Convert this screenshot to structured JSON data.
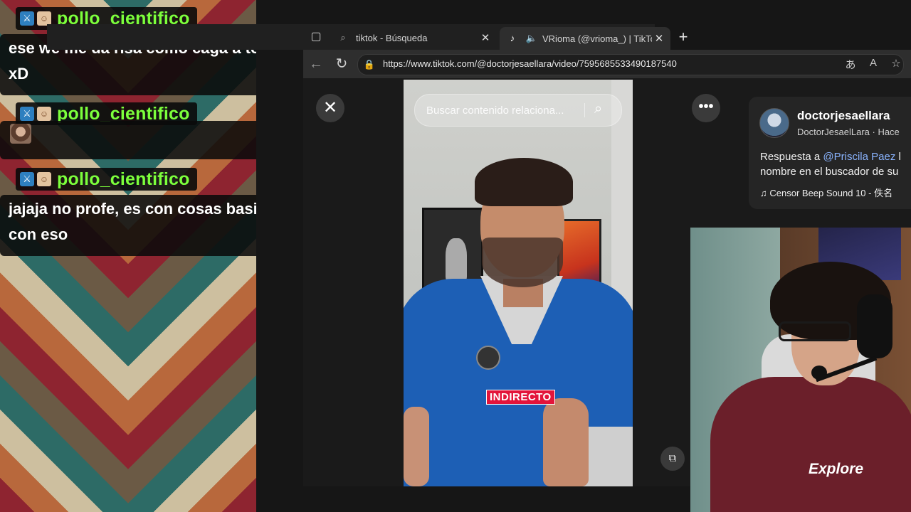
{
  "chat": {
    "messages": [
      {
        "username": "pollo_cientifico",
        "text_line1": "ese we me da risa como caga a todos",
        "text_line2": "xD"
      },
      {
        "username": "pollo_cientifico",
        "emote": "face-emote"
      },
      {
        "username": "pollo_cientifico",
        "text_line1": "jajaja no profe, es con cosas basicas no",
        "text_line2": "con eso"
      }
    ]
  },
  "browser": {
    "tabs": [
      {
        "title": "tiktok - Búsqueda",
        "active": false
      },
      {
        "title": "VRioma (@vrioma_) | TikTok",
        "active": true
      }
    ],
    "url": "https://www.tiktok.com/@doctorjesaellara/video/7595685533490187540"
  },
  "tiktok": {
    "search_placeholder": "Buscar contenido relaciona...",
    "caption": "INDIRECTO",
    "author": {
      "name": "doctorjesaellara",
      "subtitle": "DoctorJesaelLara · Hace"
    },
    "description": {
      "prefix": "Respuesta a ",
      "mention": "@Priscila Paez",
      "rest": " l",
      "line2": "nombre en el buscador de su"
    },
    "sound": "Censor Beep Sound 10 - 佚名"
  },
  "webcam": {
    "shirt_text": "Explore"
  },
  "colors": {
    "username": "#7cff3c",
    "caption_bg": "#e3143a",
    "mention": "#8ab4ff"
  }
}
